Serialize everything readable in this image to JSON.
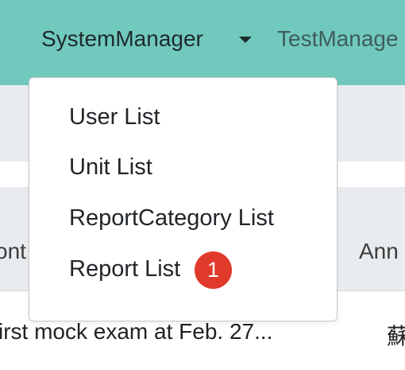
{
  "navbar": {
    "system_manager_label": "SystemManager",
    "test_manager_label": "TestManage",
    "background": "#71c9bd"
  },
  "dropdown": {
    "items": [
      {
        "label": "User List"
      },
      {
        "label": "Unit List"
      },
      {
        "label": "ReportCategory List"
      },
      {
        "label": "Report List"
      }
    ],
    "badge": "1",
    "badge_color": "#e03a2a"
  },
  "table": {
    "headers": [
      "ont",
      "Ann"
    ],
    "row": [
      "irst mock exam at Feb. 27...",
      "蘇"
    ]
  }
}
